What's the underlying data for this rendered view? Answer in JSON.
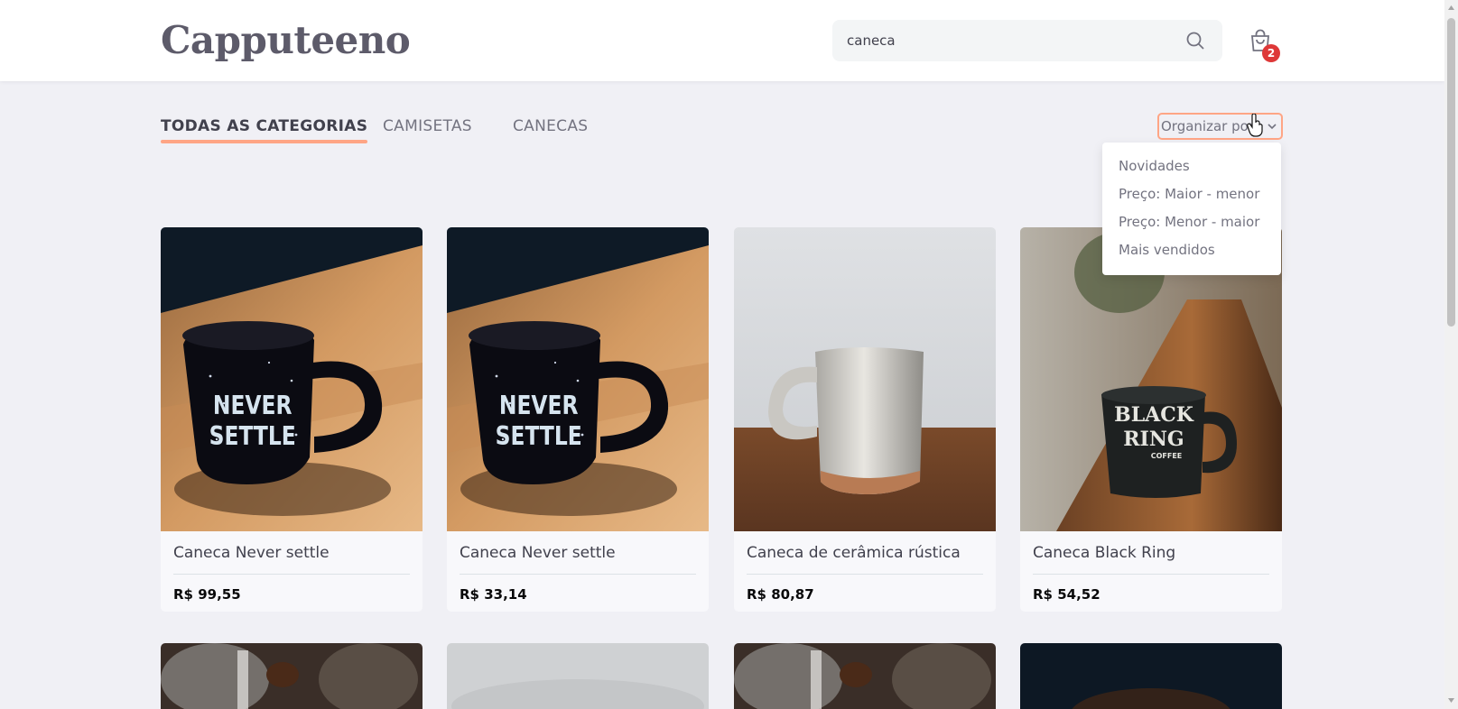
{
  "header": {
    "logo": "Capputeeno",
    "search_value": "caneca",
    "cart_count": "2"
  },
  "tabs": [
    {
      "label": "TODAS AS CATEGORIAS",
      "active": true
    },
    {
      "label": "CAMISETAS",
      "active": false
    },
    {
      "label": "CANECAS",
      "active": false
    }
  ],
  "sort": {
    "label": "Organizar por",
    "options": [
      "Novidades",
      "Preço: Maior - menor",
      "Preço: Menor - maior",
      "Mais vendidos"
    ]
  },
  "products": [
    {
      "name": "Caneca Never settle",
      "price": "R$ 99,55",
      "image": "mug-never-settle"
    },
    {
      "name": "Caneca Never settle",
      "price": "R$ 33,14",
      "image": "mug-never-settle"
    },
    {
      "name": "Caneca de cerâmica rústica",
      "price": "R$ 80,87",
      "image": "mug-ceramic"
    },
    {
      "name": "Caneca Black Ring",
      "price": "R$ 54,52",
      "image": "mug-black-ring"
    }
  ],
  "mug_prints": {
    "never_settle": [
      "NEVER",
      "SETTLE"
    ],
    "black_ring": [
      "BLACK",
      "RING",
      "COFFEE"
    ]
  },
  "colors": {
    "accent": "#ffa585",
    "badge": "#de3838",
    "background": "#f0f0f5",
    "text": "#41414d"
  }
}
